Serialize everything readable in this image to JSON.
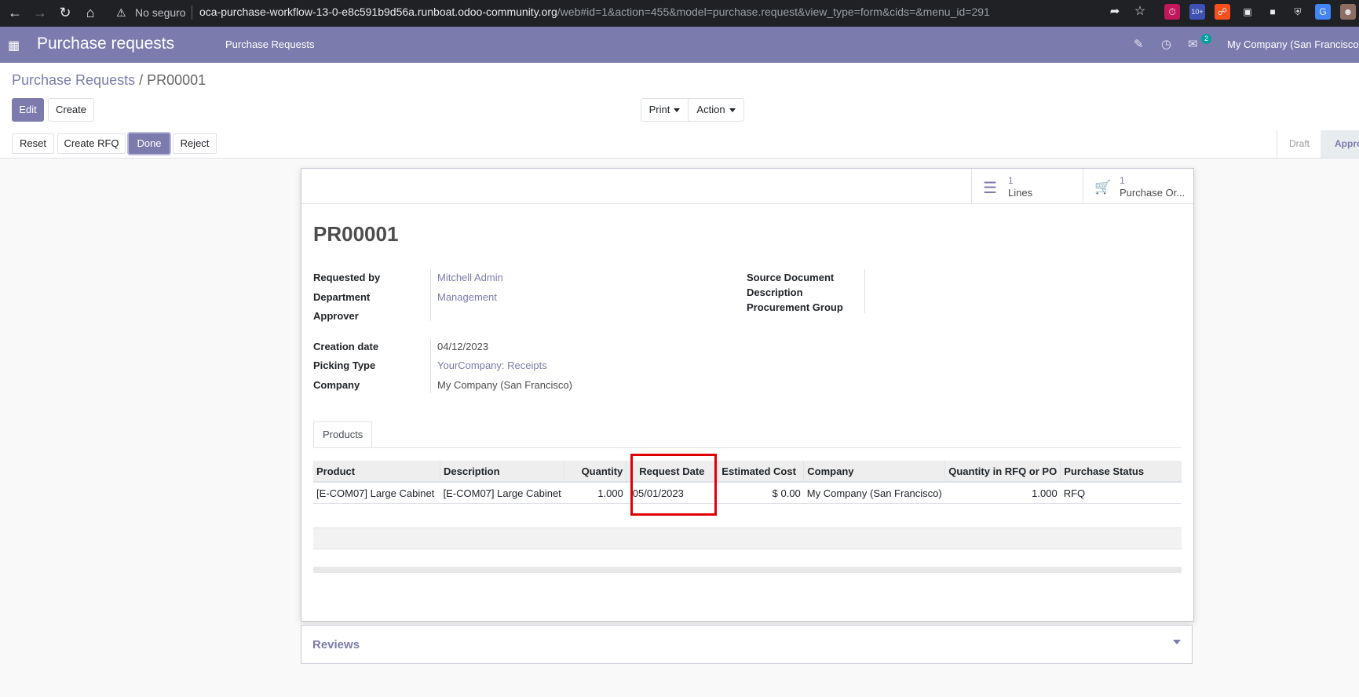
{
  "browser": {
    "security_label": "No seguro",
    "url_host": "oca-purchase-workflow-13-0-e8c591b9d56a.runboat.odoo-community.org",
    "url_path": "/web#id=1&action=455&model=purchase.request&view_type=form&cids=&menu_id=291",
    "ext_badge": "10+"
  },
  "navbar": {
    "app_title": "Purchase requests",
    "menu_item": "Purchase Requests",
    "messages_count": "2",
    "company": "My Company (San Francisco)"
  },
  "breadcrumb": {
    "parent": "Purchase Requests",
    "separator": " / ",
    "current": "PR00001"
  },
  "control_panel": {
    "edit": "Edit",
    "create": "Create",
    "print": "Print",
    "action": "Action"
  },
  "statusbar": {
    "buttons": {
      "reset": "Reset",
      "create_rfq": "Create RFQ",
      "done": "Done",
      "reject": "Reject"
    },
    "stages": {
      "draft": "Draft",
      "approved": "Appro"
    }
  },
  "smart_buttons": {
    "lines": {
      "value": "1",
      "label": "Lines"
    },
    "purchase_orders": {
      "value": "1",
      "label": "Purchase Or..."
    }
  },
  "record": {
    "name": "PR00001",
    "left_fields": {
      "requested_by": {
        "label": "Requested by",
        "value": "Mitchell Admin"
      },
      "department": {
        "label": "Department",
        "value": "Management"
      },
      "approver": {
        "label": "Approver",
        "value": ""
      },
      "creation_date": {
        "label": "Creation date",
        "value": "04/12/2023"
      },
      "picking_type": {
        "label": "Picking Type",
        "value": "YourCompany: Receipts"
      },
      "company": {
        "label": "Company",
        "value": "My Company (San Francisco)"
      }
    },
    "right_fields": {
      "source_document": {
        "label": "Source Document"
      },
      "description": {
        "label": "Description"
      },
      "procurement_group": {
        "label": "Procurement Group"
      }
    }
  },
  "tabs": {
    "products": "Products"
  },
  "lines_table": {
    "headers": {
      "product": "Product",
      "description": "Description",
      "quantity": "Quantity",
      "request_date": "Request Date",
      "estimated_cost": "Estimated Cost",
      "company": "Company",
      "qty_rfq_po": "Quantity in RFQ or PO",
      "purchase_status": "Purchase Status"
    },
    "rows": [
      {
        "product": "[E-COM07] Large Cabinet",
        "description": "[E-COM07] Large Cabinet",
        "quantity": "1.000",
        "request_date": "05/01/2023",
        "estimated_cost": "$ 0.00",
        "company": "My Company (San Francisco)",
        "qty_rfq_po": "1.000",
        "purchase_status": "RFQ"
      }
    ]
  },
  "reviews": {
    "title": "Reviews"
  },
  "colors": {
    "brand": "#7c7bad",
    "highlight": "#e00000"
  }
}
